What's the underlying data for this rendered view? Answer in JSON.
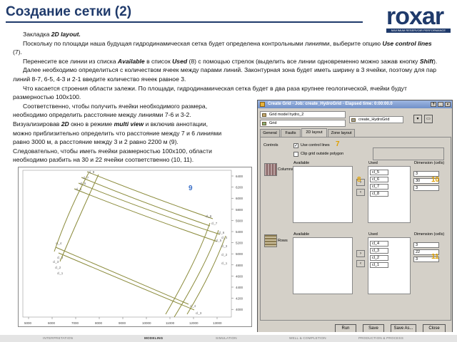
{
  "slide": {
    "title": "Создание сетки (2)"
  },
  "logo": {
    "name": "roxar",
    "tagline": "MAXIMUM RESERVOIR PERFORMANCE"
  },
  "body": {
    "p1_label": "Закладка",
    "p1_em": "2D layout.",
    "p2": "Поскольку по площади наша будущая гидродинамическая сетка будет определена контрольными линиями, выберите опцию",
    "p2_em": "Use control lines",
    "p2_end": "(7).",
    "p3_a": "Перенесите все линии из списка",
    "p3_em1": "Available",
    "p3_b": "в список",
    "p3_em2": "Used",
    "p3_c": "(8) с помощью стрелок (выделить все линии одновременно можно зажав кнопку",
    "p3_em3": "Shift",
    "p3_d": ").",
    "p4": "Далее необходимо определиться с количеством ячеек между парами линий. Законтурная зона будет иметь ширину в 3 ячейки, поэтому для пар линий 8-7, 6-5, 4-3 и 2-1 введите количество ячеек равное 3.",
    "p5": "Что касается строения области залежи. По площади, гидродинамическая сетка будет в два раза крупнее геологической, ячейки будут размерностью 100х100.",
    "p6a": "Соответственно, чтобы получить ячейки необходимого размера,",
    "p6b": "необходимо определить расстояние между линиями 7-6 и 3-2.",
    "p6c_a": "Визуализировав",
    "p6c_em": "2D",
    "p6c_b": "окно в режиме",
    "p6c_em2": "multi view",
    "p6c_c": "и включив аннотации,",
    "p6d": "можно приблизительно определить что расстояние между 7 и 6 линиями",
    "p6e": "равно 3000 м, а расстояние между 3 и 2 равно 2200 м (9).",
    "p6f": "Следовательно, чтобы иметь ячейки размерностью 100х100, области",
    "p6g": "необходимо разбить на 30 и 22 ячейки соответственно (10, 11)."
  },
  "plot": {
    "y_ticks": [
      "6400",
      "6200",
      "6000",
      "5800",
      "5600",
      "5400",
      "5200",
      "5000",
      "4800",
      "4600",
      "4400",
      "4200",
      "4000"
    ],
    "x_ticks": [
      "5000",
      "6000",
      "7000",
      "8000",
      "9000",
      "10000",
      "11000",
      "12000",
      "13000"
    ],
    "line_labels": [
      "cl_8",
      "cl_7",
      "cl_6",
      "cl_5",
      "cl_4",
      "cl_3",
      "cl_2",
      "cl_1"
    ],
    "line_color": "#8a8a3a"
  },
  "dialog": {
    "title": "Create Grid - Job: create_HydroGrid - Elapsed time: 0:00:00.0",
    "model": "Grid model hydro_2",
    "grid": "Grid",
    "job_name": "create_HydroGrid",
    "tabs": [
      "General",
      "Faults",
      "2D layout",
      "Zone layout"
    ],
    "controls_label": "Controls",
    "use_control_lines": "Use control lines",
    "clip_grid": "Clip grid outside polygon",
    "columns_label": "Columns",
    "rows_label": "Rows",
    "available": "Available",
    "used": "Used",
    "dimension": "Dimension (cells)",
    "columns_used": [
      "cl_5",
      "cl_6",
      "cl_7",
      "cl_8"
    ],
    "columns_dims": [
      "3",
      "30",
      "3"
    ],
    "rows_used": [
      "cl_4",
      "cl_3",
      "cl_2",
      "cl_1"
    ],
    "rows_dims": [
      "3",
      "22",
      "3"
    ],
    "buttons": [
      "Run",
      "Save",
      "Save As...",
      "Close"
    ]
  },
  "callouts": {
    "c7": "7",
    "c8": "8",
    "c9": "9",
    "c10": "10",
    "c11": "11"
  },
  "footer": {
    "items": [
      "INTERPRETATION",
      "MODELING",
      "SIMULATION",
      "WELL & COMPLETION",
      "PRODUCTION & PROCESS"
    ],
    "active_index": 1
  }
}
